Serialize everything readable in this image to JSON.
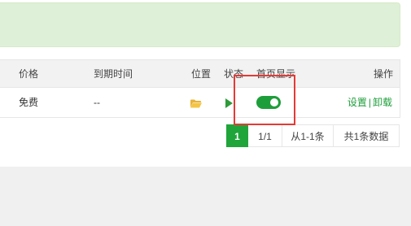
{
  "table": {
    "headers": {
      "price": "价格",
      "expire": "到期时间",
      "location": "位置",
      "status": "状态",
      "homepage": "首页显示",
      "actions": "操作"
    },
    "row": {
      "price": "免费",
      "expire": "--",
      "location_icon": "folder-icon",
      "status_icon": "play-icon",
      "homepage_toggle_on": true,
      "action_settings": "设置",
      "action_separator": "|",
      "action_uninstall": "卸载"
    }
  },
  "pagination": {
    "current": "1",
    "pages": "1/1",
    "range": "从1-1条",
    "total": "共1条数据"
  },
  "colors": {
    "accent_green": "#20a53a",
    "notice_bg": "#dff0d8",
    "highlight_red": "#e53935"
  }
}
